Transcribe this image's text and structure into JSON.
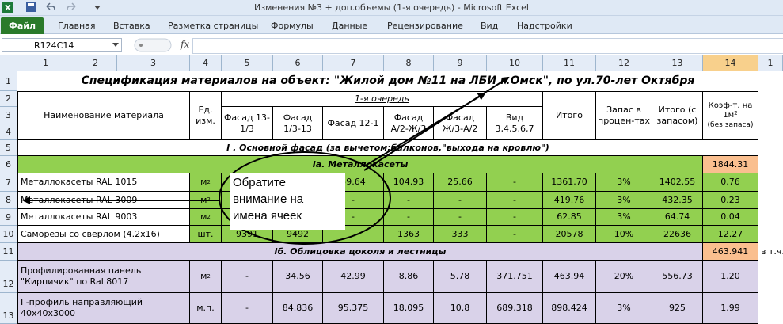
{
  "window": {
    "title": "Изменения №3 + доп.объемы (1-я очередь)  -  Microsoft Excel"
  },
  "ribbon": {
    "file_tab": "Файл",
    "tabs": [
      "Главная",
      "Вставка",
      "Разметка страницы",
      "Формулы",
      "Данные",
      "Рецензирование",
      "Вид",
      "Надстройки"
    ]
  },
  "formula_bar": {
    "name_box": "R124C14",
    "fx": "fx",
    "value": ""
  },
  "grid": {
    "col_headers": [
      "1",
      "2",
      "3",
      "4",
      "5",
      "6",
      "7",
      "8",
      "9",
      "10",
      "11",
      "12",
      "13",
      "14",
      "1"
    ],
    "row_headers": [
      "1",
      "2",
      "3",
      "4",
      "5",
      "6",
      "7",
      "8",
      "9",
      "10",
      "11",
      "12",
      "13"
    ],
    "selected_col": "14",
    "title": "Спецификация материалов на объект:  \"Жилой дом №11 на ЛБИ г.Омск\", по ул.70-лет Октября",
    "head": {
      "material": "Наименование материала",
      "unit": "Ед. изм.",
      "stage": "1-я очередь",
      "c5": "Фасад 13-1/3",
      "c6": "Фасад 1/3-13",
      "c7": "Фасад 12-1",
      "c8": "Фасад А/2-Ж/3",
      "c9": "Фасад Ж/3-А/2",
      "c10": "Вид 3,4,5,6,7",
      "c11": "Итого",
      "c12": "Запас в процен-тах",
      "c13": "Итого (с запасом)",
      "c14_top": "Коэф-т. на 1м",
      "c14_bottom": "(без запаса)"
    },
    "section_main": "I . Основной фасад (за вычетом:балконов,\"выхода на кровлю\")",
    "section_a": "Iа. Металлокасеты",
    "section_a_total": "1844.31",
    "section_b": "Iб. Облицовка цоколя и лестницы",
    "section_b_total": "463.941",
    "section_b_note": "в т.ч.",
    "rows": [
      {
        "name": "Металлокасеты RAL 1015",
        "unit": "м",
        "c5": "",
        "c6": "",
        "c7": "59.64",
        "c8": "104.93",
        "c9": "25.66",
        "c10": "-",
        "c11": "1361.70",
        "c12": "3%",
        "c13": "1402.55",
        "c14": "0.76"
      },
      {
        "name": "Металлокасеты RAL 3009",
        "unit": "м",
        "c5": "",
        "c6": "",
        "c7": "-",
        "c8": "-",
        "c9": "-",
        "c10": "-",
        "c11": "419.76",
        "c12": "3%",
        "c13": "432.35",
        "c14": "0.23"
      },
      {
        "name": "Металлокасеты RAL 9003",
        "unit": "м",
        "c5": "",
        "c6": "",
        "c7": "-",
        "c8": "-",
        "c9": "-",
        "c10": "-",
        "c11": "62.85",
        "c12": "3%",
        "c13": "64.74",
        "c14": "0.04"
      },
      {
        "name": "Саморезы со сверлом (4.2х16)",
        "unit": "шт.",
        "c5": "9391",
        "c6": "9492",
        "c7": "",
        "c8": "1363",
        "c9": "333",
        "c10": "-",
        "c11": "20578",
        "c12": "10%",
        "c13": "22636",
        "c14": "12.27"
      },
      {
        "name": "Профилированная панель \"Кирпичик\" по Ral 8017",
        "unit": "м",
        "c5": "-",
        "c6": "34.56",
        "c7": "42.99",
        "c8": "8.86",
        "c9": "5.78",
        "c10": "371.751",
        "c11": "463.94",
        "c12": "20%",
        "c13": "556.73",
        "c14": "1.20"
      },
      {
        "name": "Г-профиль направляющий 40х40х3000",
        "unit": "м.п.",
        "c5": "-",
        "c6": "84.836",
        "c7": "95.375",
        "c8": "18.095",
        "c9": "10.8",
        "c10": "689.318",
        "c11": "898.424",
        "c12": "3%",
        "c13": "925",
        "c14": "1.99"
      }
    ],
    "superscript": "2"
  },
  "callout": {
    "lines": [
      "Обратите",
      "внимание на",
      "имена ячеек"
    ]
  },
  "colors": {
    "green": "#92d050",
    "purple": "#d9d2e9",
    "orange": "#fabf8f",
    "header_selected": "#f8d08c",
    "file_tab": "#2a7a2a"
  }
}
